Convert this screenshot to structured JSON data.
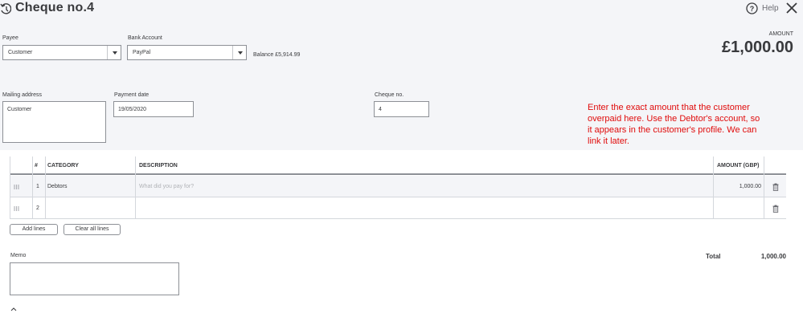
{
  "header": {
    "title": "Cheque no.4",
    "help_label": "Help"
  },
  "payee": {
    "label": "Payee",
    "value": "Customer"
  },
  "bank_account": {
    "label": "Bank Account",
    "value": "PayPal",
    "balance": "Balance £5,914.99"
  },
  "amount": {
    "label": "AMOUNT",
    "value": "£1,000.00"
  },
  "mailing_address": {
    "label": "Mailing address",
    "value": "Customer"
  },
  "payment_date": {
    "label": "Payment date",
    "value": "19/05/2020"
  },
  "cheque_no": {
    "label": "Cheque no.",
    "value": "4"
  },
  "annotation": {
    "text": "Enter the exact amount that the customer overpaid here. Use the Debtor's account, so it appears in the customer's profile. We can link it later.",
    "color": "#e00b0b"
  },
  "table": {
    "columns": {
      "number": "#",
      "category": "CATEGORY",
      "description": "DESCRIPTION",
      "amount": "AMOUNT (GBP)"
    },
    "rows": [
      {
        "number": "1",
        "category": "Debtors",
        "description": "",
        "description_placeholder": "What did you pay for?",
        "amount": "1,000.00"
      },
      {
        "number": "2",
        "category": "",
        "description": "",
        "description_placeholder": "",
        "amount": ""
      }
    ]
  },
  "buttons": {
    "add_lines": "Add lines",
    "clear_all_lines": "Clear all lines"
  },
  "total": {
    "label": "Total",
    "value": "1,000.00"
  },
  "memo": {
    "label": "Memo",
    "value": ""
  }
}
